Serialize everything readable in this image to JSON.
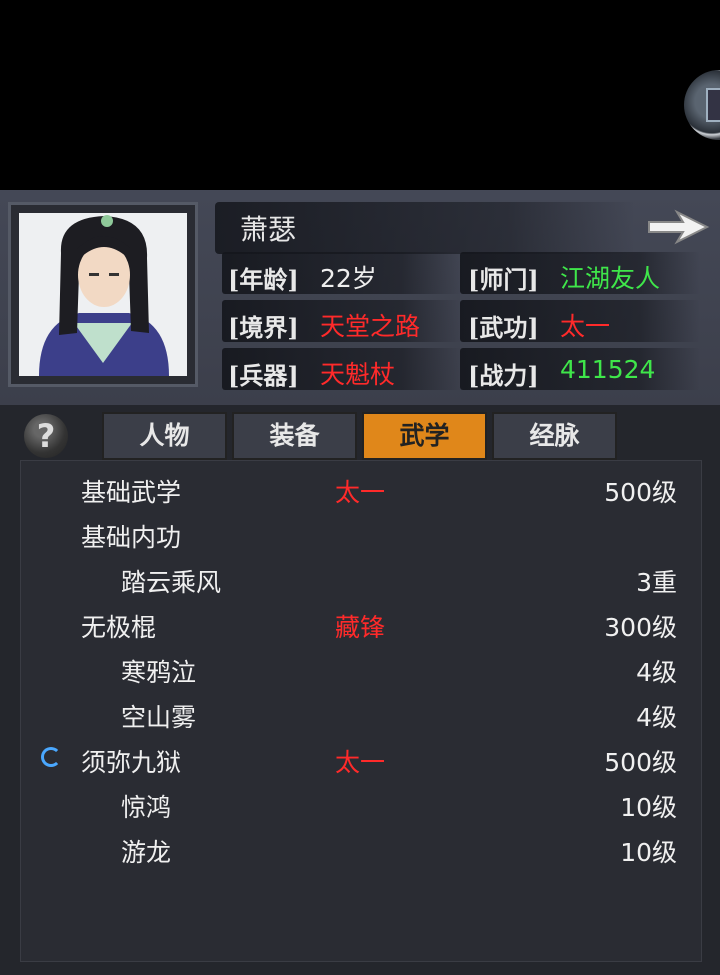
{
  "character": {
    "name": "萧瑟",
    "stats": [
      {
        "key": "[年龄]",
        "value": "22岁",
        "color": "white"
      },
      {
        "key": "[师门]",
        "value": "江湖友人",
        "color": "green"
      },
      {
        "key": "[境界]",
        "value": "天堂之路",
        "color": "red"
      },
      {
        "key": "[武功]",
        "value": "太一",
        "color": "red"
      },
      {
        "key": "[兵器]",
        "value": "天魁杖",
        "color": "red"
      },
      {
        "key": "[战力]",
        "value": "411524",
        "color": "green"
      }
    ]
  },
  "help_label": "?",
  "tabs": [
    {
      "label": "人物",
      "active": false
    },
    {
      "label": "装备",
      "active": false
    },
    {
      "label": "武学",
      "active": true
    },
    {
      "label": "经脉",
      "active": false
    }
  ],
  "skills": [
    {
      "name": "基础武学",
      "style": "太一",
      "level": "500级",
      "indent": 0,
      "spinner": false
    },
    {
      "name": "基础内功",
      "style": "",
      "level": "",
      "indent": 0,
      "spinner": false
    },
    {
      "name": "踏云乘风",
      "style": "",
      "level": "3重",
      "indent": 1,
      "spinner": false
    },
    {
      "name": "无极棍",
      "style": "藏锋",
      "level": "300级",
      "indent": 0,
      "spinner": false
    },
    {
      "name": "寒鸦泣",
      "style": "",
      "level": "4级",
      "indent": 1,
      "spinner": false
    },
    {
      "name": "空山雾",
      "style": "",
      "level": "4级",
      "indent": 1,
      "spinner": false
    },
    {
      "name": "须弥九狱",
      "style": "太一",
      "level": "500级",
      "indent": 0,
      "spinner": true
    },
    {
      "name": "惊鸿",
      "style": "",
      "level": "10级",
      "indent": 1,
      "spinner": false
    },
    {
      "name": "游龙",
      "style": "",
      "level": "10级",
      "indent": 1,
      "spinner": false
    }
  ],
  "colors": {
    "accent_tab": "#e0871a",
    "red": "#ff2a2a",
    "green": "#3fe64a"
  }
}
